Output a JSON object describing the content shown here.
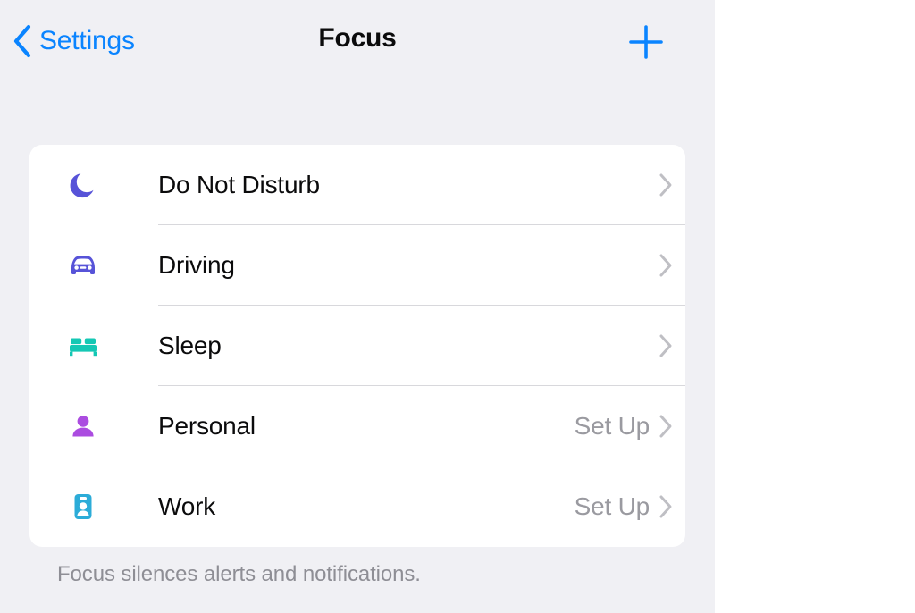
{
  "nav": {
    "back_label": "Settings",
    "back_icon": "chevron-left-icon",
    "title": "Focus",
    "add_icon": "plus-icon",
    "accent_color": "#0a84ff"
  },
  "focus_list": {
    "rows": [
      {
        "label": "Do Not Disturb",
        "icon": "moon-icon",
        "icon_color": "#5753d8",
        "value": "",
        "chevron": "chevron-right-icon"
      },
      {
        "label": "Driving",
        "icon": "car-icon",
        "icon_color": "#5753d8",
        "value": "",
        "chevron": "chevron-right-icon"
      },
      {
        "label": "Sleep",
        "icon": "bed-icon",
        "icon_color": "#14c8b4",
        "value": "",
        "chevron": "chevron-right-icon"
      },
      {
        "label": "Personal",
        "icon": "person-icon",
        "icon_color": "#ab4ce0",
        "value": "Set Up",
        "chevron": "chevron-right-icon"
      },
      {
        "label": "Work",
        "icon": "id-badge-icon",
        "icon_color": "#2cacd8",
        "value": "Set Up",
        "chevron": "chevron-right-icon"
      }
    ]
  },
  "footer": {
    "note": "Focus silences alerts and notifications."
  },
  "theme": {
    "background": "#f0f0f4",
    "card_background": "#ffffff",
    "primary_text": "#0b0b0c",
    "secondary_text": "#9a9aa0",
    "divider": "#d8d8dc"
  }
}
